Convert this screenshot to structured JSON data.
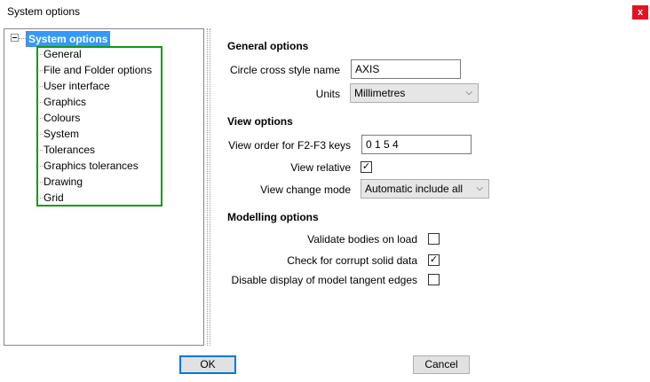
{
  "window": {
    "title": "System options",
    "close_glyph": "x"
  },
  "tree": {
    "root": "System options",
    "items": [
      "General",
      "File and Folder options",
      "User interface",
      "Graphics",
      "Colours",
      "System",
      "Tolerances",
      "Graphics tolerances",
      "Drawing",
      "Grid"
    ],
    "highlight_color": "#119911"
  },
  "general": {
    "heading": "General options",
    "circle_label": "Circle cross style name",
    "circle_value": "AXIS",
    "units_label": "Units",
    "units_value": "Millimetres"
  },
  "view": {
    "heading": "View options",
    "order_label": "View order for F2-F3 keys",
    "order_value": "0 1 5 4",
    "relative_label": "View relative",
    "relative_checked": true,
    "change_label": "View change mode",
    "change_value": "Automatic include all"
  },
  "modelling": {
    "heading": "Modelling options",
    "validate_label": "Validate bodies on load",
    "validate_checked": false,
    "corrupt_label": "Check for corrupt solid data",
    "corrupt_checked": true,
    "tangent_label": "Disable display of model tangent edges",
    "tangent_checked": false
  },
  "buttons": {
    "ok": "OK",
    "cancel": "Cancel"
  },
  "glyphs": {
    "check": "✓",
    "dropdown": "⌵"
  },
  "colors": {
    "selection": "#3399ff",
    "close": "#e81123",
    "default_button": "#0078d7"
  }
}
